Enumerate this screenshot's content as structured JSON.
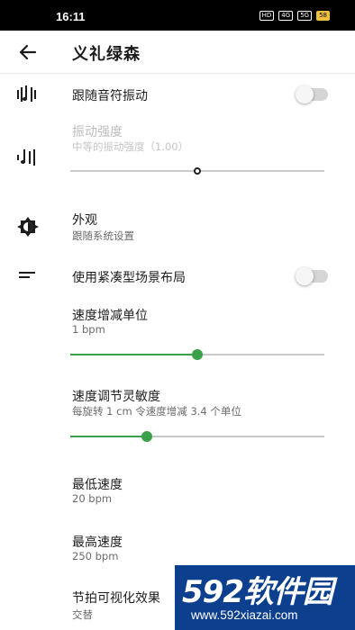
{
  "status_bar": {
    "time": "16:11",
    "icons": [
      "hd-icon",
      "signal-4g-icon",
      "signal-5g-icon",
      "battery-icon"
    ],
    "icon_texts": [
      "HD",
      "4G",
      "5G",
      "58"
    ],
    "battery": "58"
  },
  "app_bar": {
    "title": "义礼绿森"
  },
  "settings": {
    "vibrate_follow": {
      "title": "跟随音符振动",
      "enabled": false
    },
    "vibration_strength": {
      "title": "振动强度",
      "subtitle": "中等的振动强度（1.00）",
      "value": 0.5
    },
    "appearance": {
      "title": "外观",
      "subtitle": "跟随系统设置"
    },
    "compact_layout": {
      "title": "使用紧凑型场景布局",
      "enabled": false
    },
    "tempo_step": {
      "title": "速度增减单位",
      "subtitle": "1 bpm",
      "value": 0.5
    },
    "tempo_sensitivity": {
      "title": "速度调节灵敏度",
      "subtitle": "每旋转 1 cm 令速度增减 3.4 个单位",
      "value": 0.3
    },
    "min_tempo": {
      "title": "最低速度",
      "subtitle": "20 bpm"
    },
    "max_tempo": {
      "title": "最高速度",
      "subtitle": "250 bpm"
    },
    "beat_visual": {
      "title": "节拍可视化效果",
      "subtitle": "交替"
    }
  },
  "watermark": {
    "brand": "592软件园",
    "url": "www.592xiazai.com"
  },
  "colors": {
    "accent": "#3aa04a",
    "status_bar": "#000000",
    "watermark_bg": "#0d3f8f"
  }
}
